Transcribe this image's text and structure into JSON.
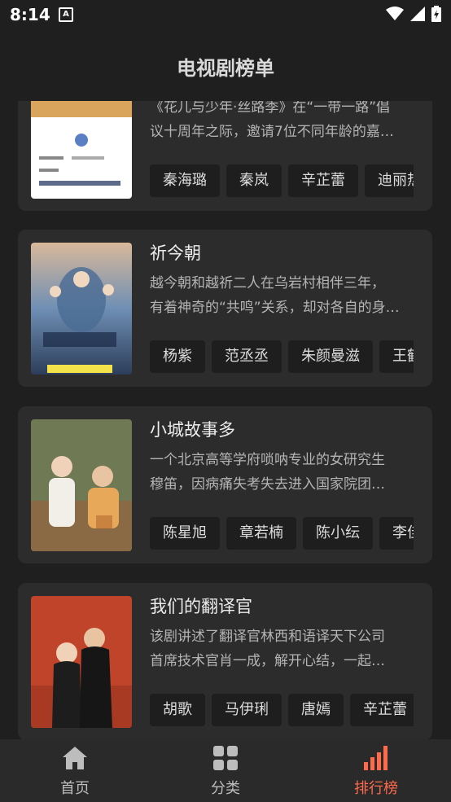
{
  "status": {
    "time": "8:14",
    "notif": "A"
  },
  "header": {
    "title": "电视剧榜单"
  },
  "dramas": [
    {
      "title": "",
      "desc": [
        "《花儿与少年·丝路季》在“一带一路”倡",
        "议十周年之际，邀请7位不同年龄的嘉…"
      ],
      "actors": [
        "秦海璐",
        "秦岚",
        "辛芷蕾",
        "迪丽热"
      ],
      "poster_colors": [
        "#e8c27a",
        "#ffffff"
      ]
    },
    {
      "title": "祈今朝",
      "desc": [
        "越今朝和越祈二人在乌岩村相伴三年，",
        "有着神奇的“共鸣”关系，却对各自的身…"
      ],
      "actors": [
        "杨紫",
        "范丞丞",
        "朱颜曼滋",
        "王鹤"
      ],
      "poster_colors": [
        "#6f8fb4",
        "#d8b89a"
      ]
    },
    {
      "title": "小城故事多",
      "desc": [
        "一个北京高等学府唢呐专业的女研究生",
        "穆笛，因病痛失考失去进入国家院团…"
      ],
      "actors": [
        "陈星旭",
        "章若楠",
        "陈小纭",
        "李佳"
      ],
      "poster_colors": [
        "#6f7a55",
        "#e8a85a"
      ]
    },
    {
      "title": "我们的翻译官",
      "desc": [
        "该剧讲述了翻译官林西和语译天下公司",
        "首席技术官肖一成，解开心结，一起…"
      ],
      "actors": [
        "胡歌",
        "马伊琍",
        "唐嫣",
        "辛芷蕾"
      ],
      "poster_colors": [
        "#c0442a",
        "#1d1d1d"
      ]
    }
  ],
  "nav": [
    {
      "label": "首页",
      "icon": "home-icon",
      "active": false
    },
    {
      "label": "分类",
      "icon": "grid-icon",
      "active": false
    },
    {
      "label": "排行榜",
      "icon": "ranking-icon",
      "active": true
    }
  ],
  "accent_color": "#ff6a4d"
}
